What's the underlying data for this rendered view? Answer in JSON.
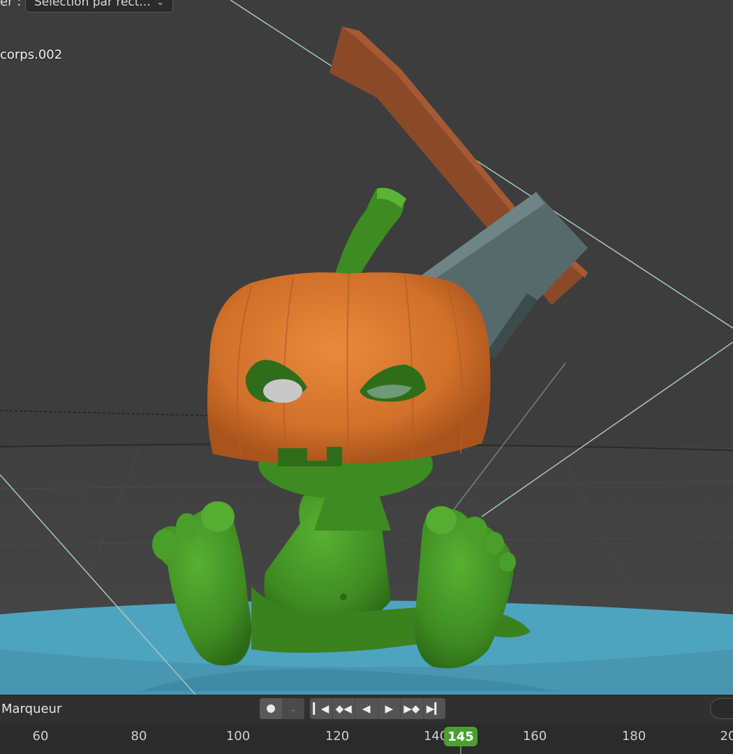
{
  "header": {
    "label": "er :",
    "select_mode": "Sélection par rect..."
  },
  "viewport": {
    "object_name": "corps.002",
    "colors": {
      "background": "#3d3d3d",
      "pumpkin": "#d9792e",
      "body": "#3f8f24",
      "axe_handle": "#8a4a2a",
      "axe_blade": "#566a6c",
      "ground": "#4ea4bf",
      "camera_lines": "#a8c8c0"
    }
  },
  "timeline": {
    "marker_menu": "Marqueur",
    "playback_icons": [
      "jump-start-icon",
      "prev-keyframe-icon",
      "play-reverse-icon",
      "play-icon",
      "next-keyframe-icon",
      "jump-end-icon"
    ],
    "ticks": [
      "60",
      "80",
      "100",
      "120",
      "140",
      "160",
      "180",
      "20"
    ],
    "current_frame": "145",
    "accent": "#4c9e33"
  }
}
